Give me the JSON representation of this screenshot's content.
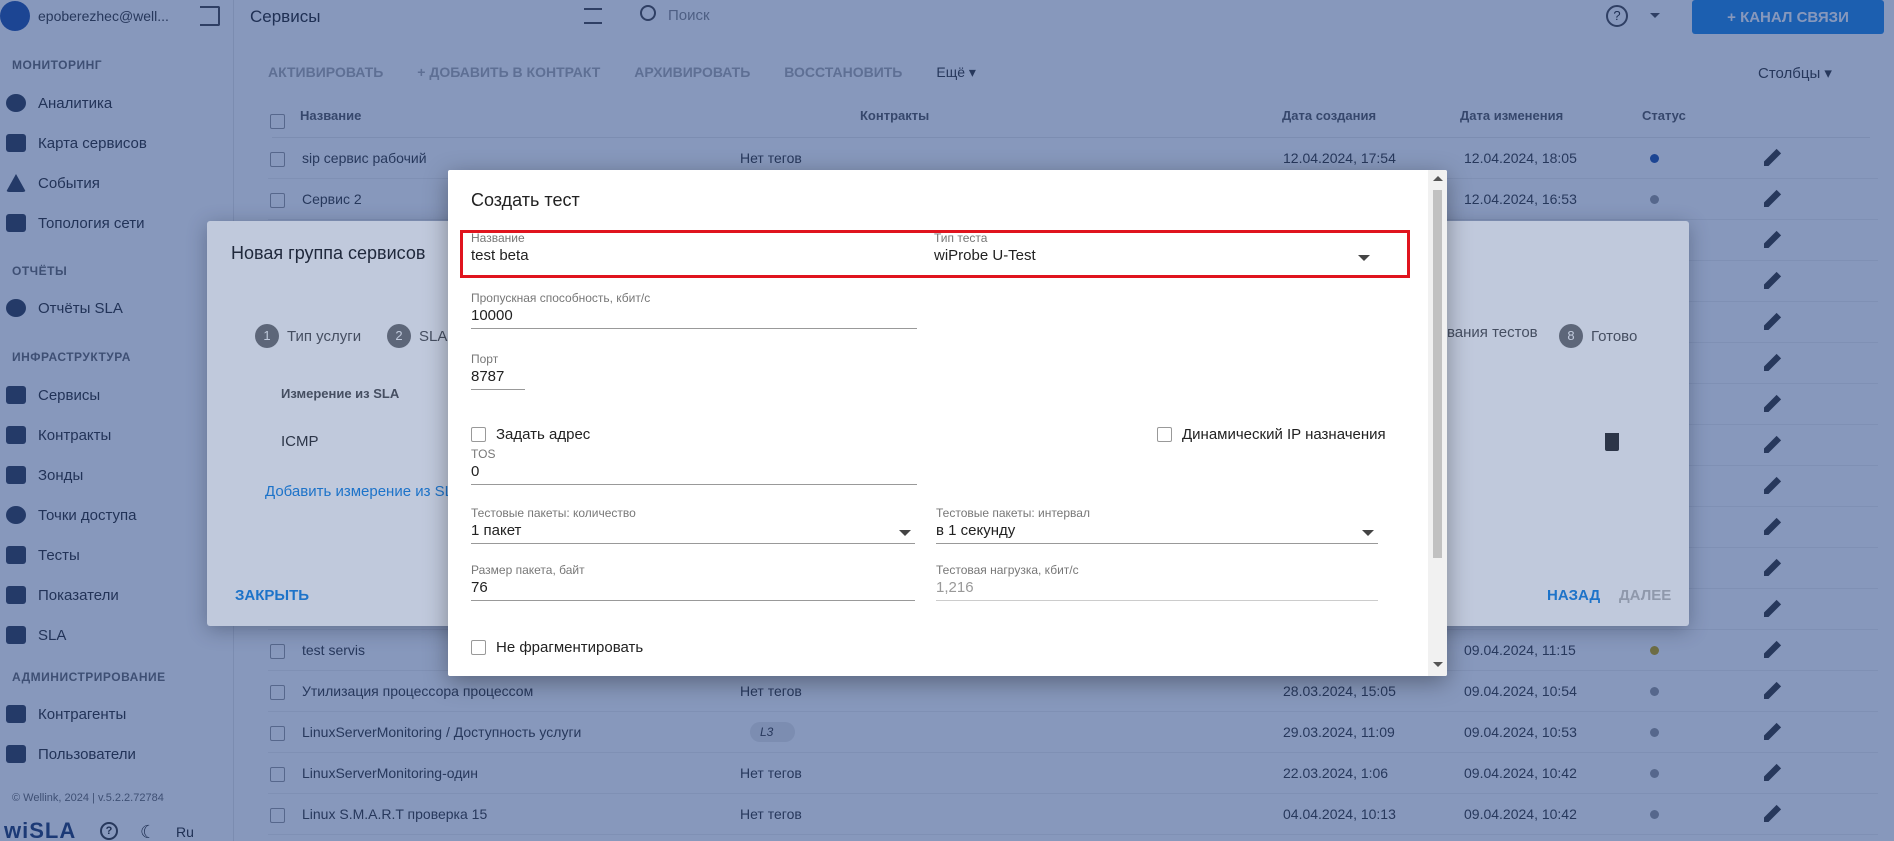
{
  "sidebar": {
    "user": "epoberezhec@well...",
    "sections": {
      "monitoring": "МОНИТОРИНГ",
      "reports": "ОТЧЁТЫ",
      "infra": "ИНФРАСТРУКТУРА",
      "admin": "АДМИНИСТРИРОВАНИЕ"
    },
    "items": [
      {
        "label": "Аналитика"
      },
      {
        "label": "Карта сервисов"
      },
      {
        "label": "События"
      },
      {
        "label": "Топология сети"
      },
      {
        "label": "Отчёты SLA"
      },
      {
        "label": "Сервисы"
      },
      {
        "label": "Контракты"
      },
      {
        "label": "Зонды"
      },
      {
        "label": "Точки доступа"
      },
      {
        "label": "Тесты"
      },
      {
        "label": "Показатели"
      },
      {
        "label": "SLA"
      },
      {
        "label": "Контрагенты"
      },
      {
        "label": "Пользователи"
      }
    ],
    "version": "© Wellink, 2024 | v.5.2.2.72784",
    "brand": "wiSLA",
    "lang": "Ru"
  },
  "header": {
    "title": "Сервисы",
    "search_placeholder": "Поиск",
    "channel_button": "+ КАНАЛ СВЯЗИ"
  },
  "toolbar": {
    "activate": "АКТИВИРОВАТЬ",
    "add_contract": "+ ДОБАВИТЬ В КОНТРАКТ",
    "archive": "АРХИВИРОВАТЬ",
    "restore": "ВОССТАНОВИТЬ",
    "more": "Ещё ▾",
    "columns": "Столбцы ▾"
  },
  "table": {
    "headers": {
      "name": "Название",
      "contracts": "Контракты",
      "created": "Дата создания",
      "modified": "Дата изменения",
      "status": "Статус"
    },
    "rows_top": [
      {
        "name": "sip сервис рабочий",
        "tags": "Нет тегов",
        "created": "12.04.2024, 17:54",
        "modified": "12.04.2024, 18:05"
      },
      {
        "name": "Сервис 2",
        "tags": "",
        "created": "",
        "modified": "12.04.2024, 16:53"
      }
    ],
    "rows_bottom": [
      {
        "name": "test servis",
        "tags": "",
        "created": "",
        "modified": "09.04.2024, 11:15"
      },
      {
        "name": "Утилизация процессора процессом",
        "tags": "Нет тегов",
        "created": "28.03.2024, 15:05",
        "modified": "09.04.2024, 10:54"
      },
      {
        "name": "LinuxServerMonitoring / Доступность услуги",
        "tags": "L3",
        "created": "29.03.2024, 11:09",
        "modified": "09.04.2024, 10:53"
      },
      {
        "name": "LinuxServerMonitoring-один",
        "tags": "Нет тегов",
        "created": "22.03.2024, 1:06",
        "modified": "09.04.2024, 10:42"
      },
      {
        "name": "Linux S.M.A.R.T проверка 15",
        "tags": "Нет тегов",
        "created": "04.04.2024, 10:13",
        "modified": "09.04.2024, 10:42"
      }
    ]
  },
  "group_dialog": {
    "title": "Новая группа сервисов",
    "steps": [
      {
        "num": "1",
        "label": "Тип услуги"
      },
      {
        "num": "2",
        "label": "SLA"
      },
      {
        "num": "",
        "label": "вания тестов"
      },
      {
        "num": "8",
        "label": "Готово"
      }
    ],
    "col_header": "Измерение из SLA",
    "row_value": "ICMP",
    "add_link": "Добавить измерение из SL",
    "close": "ЗАКРЫТЬ",
    "back": "НАЗАД",
    "next": "ДАЛЕЕ"
  },
  "test_dialog": {
    "title": "Создать тест",
    "name_label": "Название",
    "name_value": "test beta",
    "type_label": "Тип теста",
    "type_value": "wiProbe U-Test",
    "bandwidth_label": "Пропускная способность, кбит/с",
    "bandwidth_value": "10000",
    "port_label": "Порт",
    "port_value": "8787",
    "set_address": "Задать адрес",
    "dynamic_ip": "Динамический IP назначения",
    "tos_label": "TOS",
    "tos_value": "0",
    "packets_count_label": "Тестовые пакеты: количество",
    "packets_count_value": "1 пакет",
    "packets_interval_label": "Тестовые пакеты: интервал",
    "packets_interval_value": "в 1 секунду",
    "packet_size_label": "Размер пакета, байт",
    "packet_size_value": "76",
    "load_label": "Тестовая нагрузка, кбит/с",
    "load_value": "1,216",
    "no_fragment": "Не фрагментировать"
  }
}
